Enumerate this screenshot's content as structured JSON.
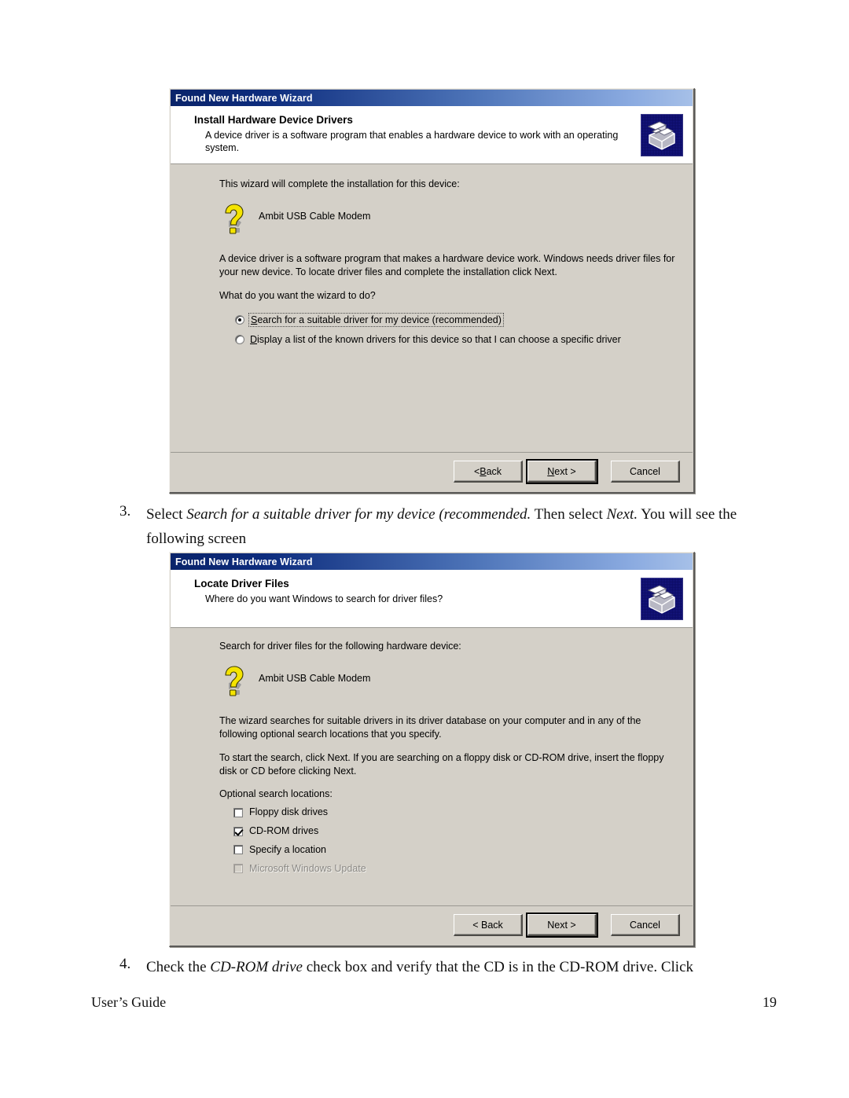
{
  "document": {
    "steps": [
      {
        "number": "3.",
        "segments": [
          {
            "text": "Select ",
            "style": "normal"
          },
          {
            "text": "Search for a suitable driver for my device (recommended.",
            "style": "italic"
          },
          {
            "text": "  Then select ",
            "style": "normal"
          },
          {
            "text": "Next.",
            "style": "italic"
          },
          {
            "text": "  You will see the following screen",
            "style": "normal"
          }
        ]
      },
      {
        "number": "4.",
        "segments": [
          {
            "text": "Check the ",
            "style": "normal"
          },
          {
            "text": "CD-ROM drive",
            "style": "italic"
          },
          {
            "text": " check box and verify that the CD is in the CD-ROM drive.  Click",
            "style": "normal"
          }
        ]
      }
    ],
    "footer": {
      "left": "User’s Guide",
      "page_number": "19"
    }
  },
  "dialog1": {
    "titlebar": "Found New Hardware Wizard",
    "header_title": "Install Hardware Device Drivers",
    "header_sub": "A device driver is a software program that enables a hardware device to work with an operating system.",
    "icon_name": "hardware-wizard-icon",
    "intro": "This wizard will complete the installation for this device:",
    "device_icon": "unknown-device-question-icon",
    "device_name": "Ambit USB Cable Modem",
    "paragraph": "A device driver is a software program that makes a hardware device work. Windows needs driver files for your new device. To locate driver files and complete the installation click Next.",
    "question": "What do you want the wizard to do?",
    "options": [
      {
        "label_accel": "S",
        "label_rest": "earch for a suitable driver for my device (recommended)",
        "checked": true,
        "focused": true
      },
      {
        "label_accel": "D",
        "label_rest": "isplay a list of the known drivers for this device so that I can choose a specific driver",
        "checked": false,
        "focused": false
      }
    ],
    "buttons": {
      "back": {
        "accel": "B",
        "pre": "< ",
        "post": "ack"
      },
      "next": {
        "accel": "N",
        "pre": "",
        "post": "ext >"
      },
      "cancel": {
        "label": "Cancel"
      }
    }
  },
  "dialog2": {
    "titlebar": "Found New Hardware Wizard",
    "header_title": "Locate Driver Files",
    "header_sub": "Where do you want Windows to search for driver files?",
    "icon_name": "hardware-wizard-icon",
    "intro": "Search for driver files for the following hardware device:",
    "device_icon": "unknown-device-question-icon",
    "device_name": "Ambit USB Cable Modem",
    "paragraph1": "The wizard searches for suitable drivers in its driver database on your computer and in any of the following optional search locations that you specify.",
    "paragraph2": "To start the search, click Next. If you are searching on a floppy disk or CD-ROM drive, insert the floppy disk or CD before clicking Next.",
    "checkbox_heading": "Optional search locations:",
    "checkboxes": [
      {
        "label": "Floppy disk drives",
        "checked": false,
        "disabled": false
      },
      {
        "label": "CD-ROM drives",
        "checked": true,
        "disabled": false
      },
      {
        "label": "Specify a location",
        "checked": false,
        "disabled": false
      },
      {
        "label": "Microsoft Windows Update",
        "checked": false,
        "disabled": true
      }
    ],
    "buttons": {
      "back": {
        "label": "< Back"
      },
      "next": {
        "label": "Next >"
      },
      "cancel": {
        "label": "Cancel"
      }
    }
  },
  "colors": {
    "titlebar_start": "#0a246a",
    "titlebar_end": "#a6c0e8",
    "dialog_face": "#d4d0c8",
    "icon_background": "#0c0c66",
    "question_mark": "#f2e300"
  }
}
